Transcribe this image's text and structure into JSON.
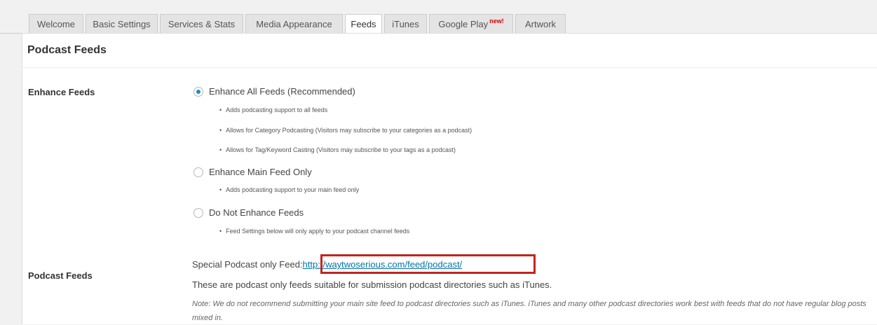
{
  "tabs": [
    {
      "label": "Welcome"
    },
    {
      "label": "Basic Settings"
    },
    {
      "label": "Services & Stats"
    },
    {
      "label": "Media Appearance"
    },
    {
      "label": "Feeds",
      "active": true
    },
    {
      "label": "iTunes"
    },
    {
      "label": "Google Play",
      "badge": "new!"
    },
    {
      "label": "Artwork"
    }
  ],
  "page_title": "Podcast Feeds",
  "enhance": {
    "label": "Enhance Feeds",
    "options": [
      {
        "label": "Enhance All Feeds (Recommended)",
        "checked": true,
        "bullets": [
          "Adds podcasting support to all feeds",
          "Allows for Category Podcasting (Visitors may subscribe to your categories as a podcast)",
          "Allows for Tag/Keyword Casting (Visitors may subscribe to your tags as a podcast)"
        ]
      },
      {
        "label": "Enhance Main Feed Only",
        "checked": false,
        "bullets": [
          "Adds podcasting support to your main feed only"
        ]
      },
      {
        "label": "Do Not Enhance Feeds",
        "checked": false,
        "bullets": [
          "Feed Settings below will only apply to your podcast channel feeds"
        ]
      }
    ]
  },
  "podcast_feeds": {
    "label": "Podcast Feeds",
    "special_label": "Special Podcast only Feed:",
    "url": "http://waytwoserious.com/feed/podcast/",
    "description": "These are podcast only feeds suitable for submission podcast directories such as iTunes.",
    "note": "Note: We do not recommend submitting your main site feed to podcast directories such as iTunes. iTunes and many other podcast directories work best with feeds that do not have regular blog posts mixed in."
  },
  "colors": {
    "link": "#0073aa",
    "highlight_border": "#c0261e",
    "radio_checked": "#1e8cbe"
  }
}
